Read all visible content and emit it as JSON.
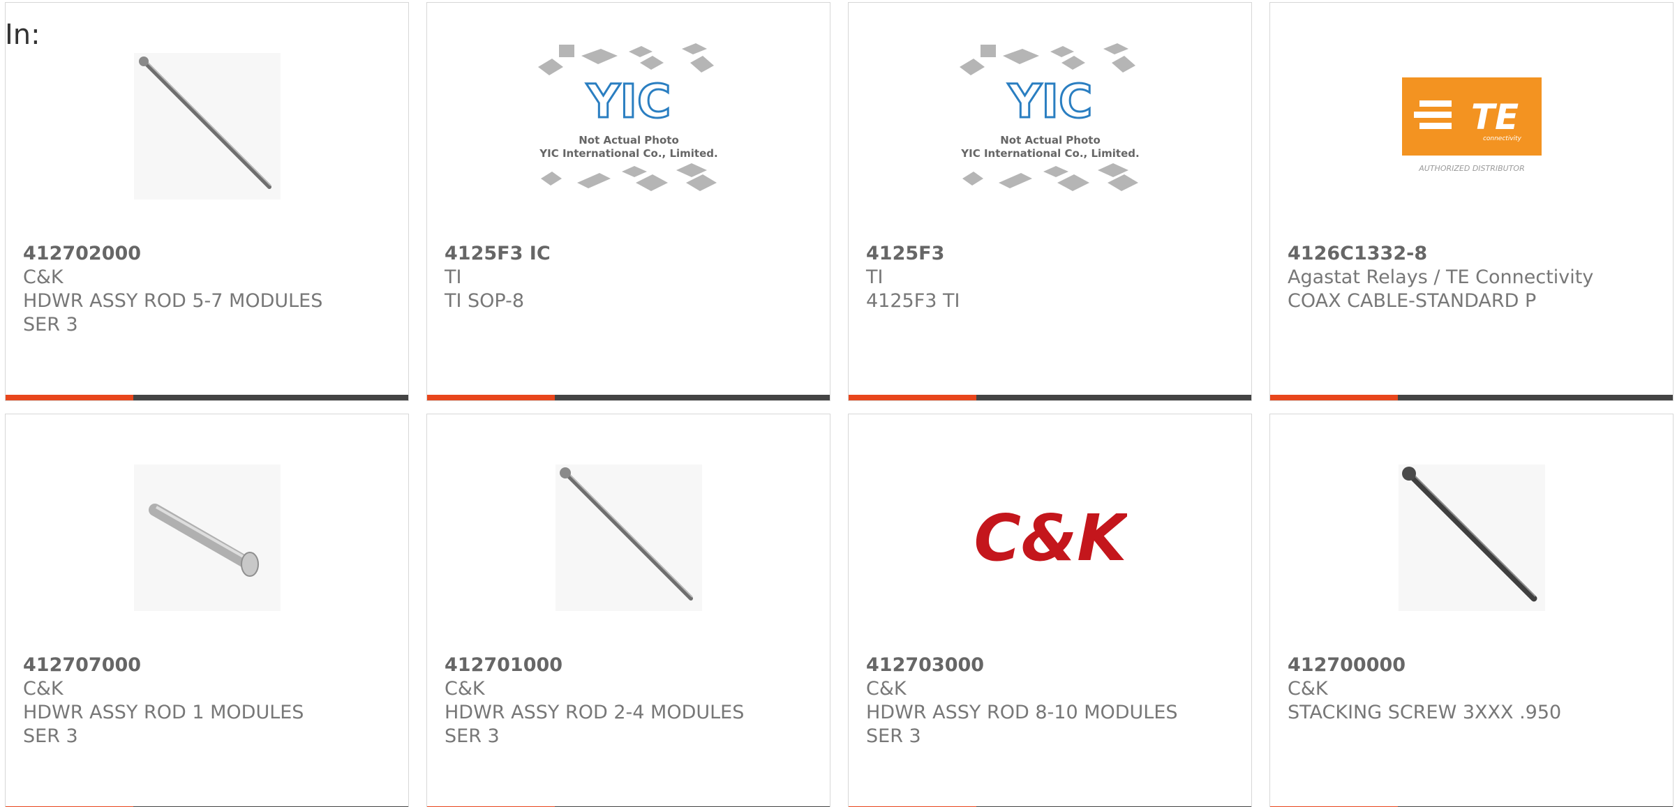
{
  "header": {
    "label": "In:"
  },
  "colors": {
    "accent": "#e8461c",
    "bar": "#444444",
    "text": "#777777",
    "te_orange": "#f39321",
    "ck_red": "#c4161c"
  },
  "cards": [
    {
      "part": "412702000",
      "maker": "C&K",
      "desc": "HDWR ASSY ROD 5-7 MODULES",
      "desc2": "SER 3",
      "image": "rod-photo"
    },
    {
      "part": "4125F3 IC",
      "maker": "TI",
      "desc": "TI SOP-8",
      "desc2": "",
      "image": "yic-placeholder",
      "image_text": {
        "logo": "YIC",
        "line1": "Not Actual Photo",
        "line2": "YIC International Co., Limited."
      }
    },
    {
      "part": "4125F3",
      "maker": "TI",
      "desc": "4125F3 TI",
      "desc2": "",
      "image": "yic-placeholder",
      "image_text": {
        "logo": "YIC",
        "line1": "Not Actual Photo",
        "line2": "YIC International Co., Limited."
      }
    },
    {
      "part": "4126C1332-8",
      "maker": "Agastat Relays / TE Connectivity",
      "desc": "COAX CABLE-STANDARD P",
      "desc2": "",
      "image": "te-logo",
      "image_text": {
        "logo": "TE",
        "sub": "connectivity",
        "caption": "AUTHORIZED DISTRIBUTOR"
      }
    },
    {
      "part": "412707000",
      "maker": "C&K",
      "desc": "HDWR ASSY ROD 1 MODULES",
      "desc2": "SER 3",
      "image": "short-rod-photo"
    },
    {
      "part": "412701000",
      "maker": "C&K",
      "desc": "HDWR ASSY ROD 2-4 MODULES",
      "desc2": "SER 3",
      "image": "rod-photo"
    },
    {
      "part": "412703000",
      "maker": "C&K",
      "desc": "HDWR ASSY ROD 8-10 MODULES",
      "desc2": "SER 3",
      "image": "ck-logo",
      "image_text": {
        "logo": "C&K"
      }
    },
    {
      "part": "412700000",
      "maker": "C&K",
      "desc": "STACKING SCREW 3XXX .950",
      "desc2": "",
      "image": "dark-rod-photo"
    }
  ]
}
